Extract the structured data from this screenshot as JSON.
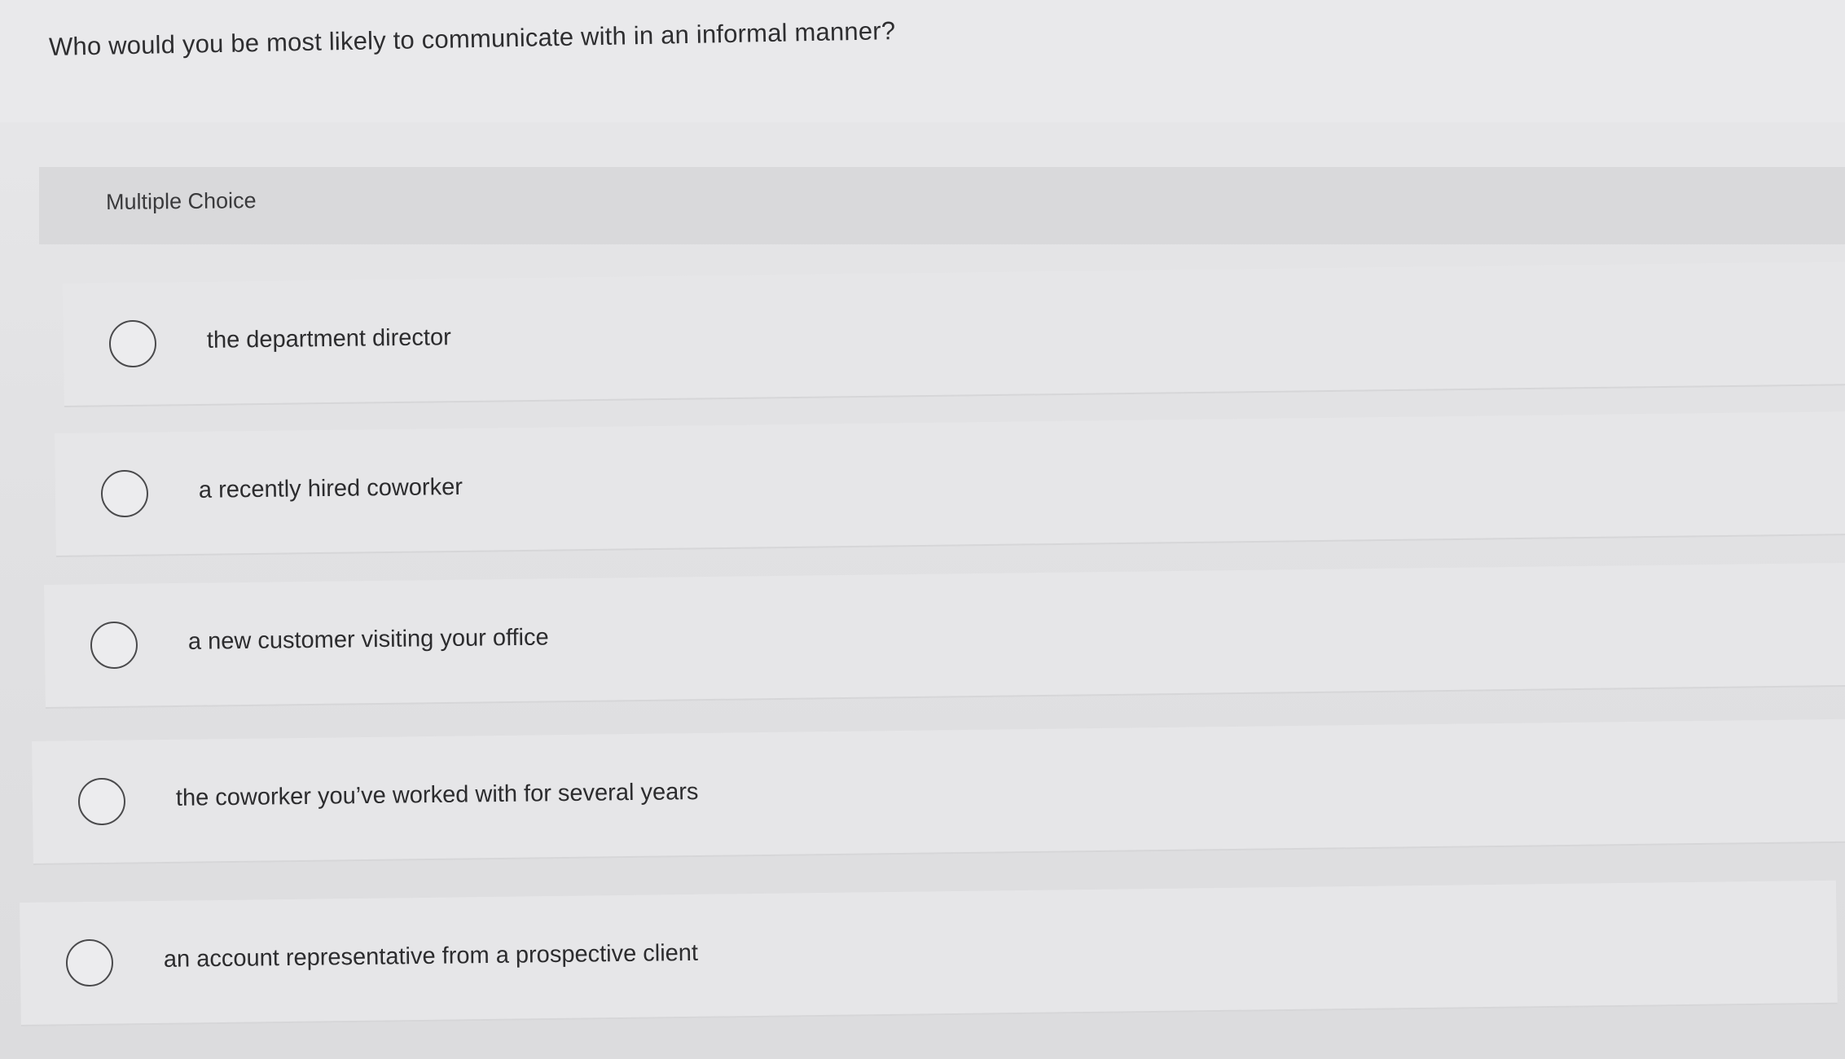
{
  "question": {
    "text": "Who would you be most likely to communicate with in an informal manner?"
  },
  "choice_type": {
    "label": "Multiple Choice"
  },
  "options": [
    {
      "label": "the department director",
      "selected": false
    },
    {
      "label": "a recently hired coworker",
      "selected": false
    },
    {
      "label": "a new customer visiting your office",
      "selected": false
    },
    {
      "label": "the coworker you’ve worked with for several years",
      "selected": false
    },
    {
      "label": "an account representative from a prospective client",
      "selected": false
    }
  ],
  "colors": {
    "background": "#e4e4e6",
    "header_band": "#d9d9db",
    "text": "#2e2e30",
    "radio_border": "#4a4a4c"
  }
}
